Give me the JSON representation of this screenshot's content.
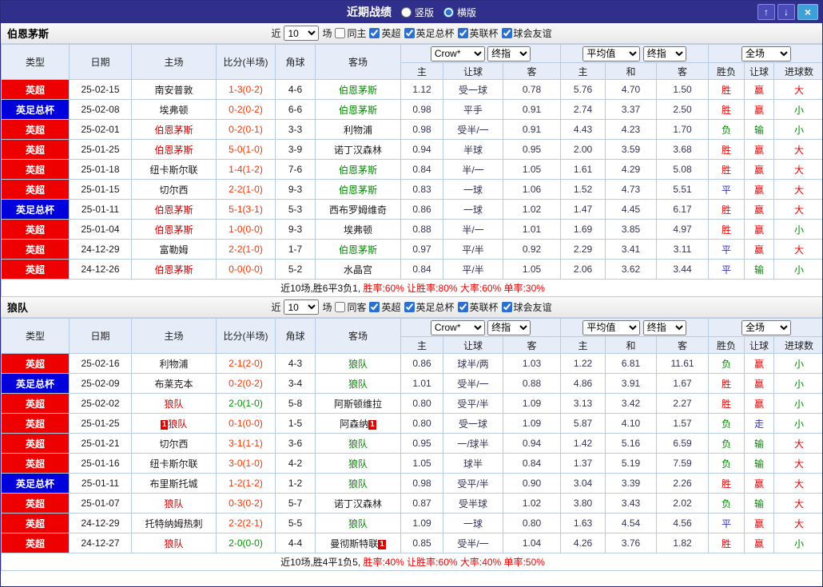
{
  "header": {
    "title": "近期战绩",
    "layout_options": [
      {
        "label": "竖版",
        "checked": false
      },
      {
        "label": "横版",
        "checked": true
      }
    ],
    "up_icon": "↑",
    "down_icon": "↓",
    "close_icon": "×"
  },
  "sections": [
    {
      "team": "伯恩茅斯",
      "filters": {
        "near": "近",
        "count": "10",
        "games": "场",
        "same": {
          "label": "同主",
          "checked": false
        },
        "leagues": [
          {
            "label": "英超",
            "checked": true
          },
          {
            "label": "英足总杯",
            "checked": true
          },
          {
            "label": "英联杯",
            "checked": true
          },
          {
            "label": "球会友谊",
            "checked": true
          }
        ]
      },
      "headers": {
        "type": "类型",
        "date": "日期",
        "home": "主场",
        "score": "比分(半场)",
        "corners": "角球",
        "away": "客场",
        "book_select": "Crow*",
        "stage_select1": "终指",
        "avg_select": "平均值",
        "stage_select2": "终指",
        "scope_select": "全场",
        "sub": [
          "主",
          "让球",
          "客",
          "主",
          "和",
          "客",
          "胜负",
          "让球",
          "进球数"
        ]
      },
      "rows": [
        {
          "league": "英超",
          "league_bg": "#ee0000",
          "date": "25-02-15",
          "home": "南安普敦",
          "home_color": "#1a1a1a",
          "home_badge": "",
          "score": "1-3(0-2)",
          "score_color": "#ff3300",
          "corners": "4-6",
          "away": "伯恩茅斯",
          "away_color": "#008800",
          "away_badge": "",
          "ah_home": "1.12",
          "handicap": "受一球",
          "ah_away": "0.78",
          "eu_home": "5.76",
          "eu_draw": "4.70",
          "eu_away": "1.50",
          "result": "胜",
          "result_color": "#ee0000",
          "cover": "赢",
          "cover_color": "#ee0000",
          "goals": "大",
          "goals_color": "#ee0000"
        },
        {
          "league": "英足总杯",
          "league_bg": "#0000dd",
          "date": "25-02-08",
          "home": "埃弗顿",
          "home_color": "#1a1a1a",
          "home_badge": "",
          "score": "0-2(0-2)",
          "score_color": "#ff3300",
          "corners": "6-6",
          "away": "伯恩茅斯",
          "away_color": "#008800",
          "away_badge": "",
          "ah_home": "0.98",
          "handicap": "平手",
          "ah_away": "0.91",
          "eu_home": "2.74",
          "eu_draw": "3.37",
          "eu_away": "2.50",
          "result": "胜",
          "result_color": "#ee0000",
          "cover": "赢",
          "cover_color": "#ee0000",
          "goals": "小",
          "goals_color": "#008800"
        },
        {
          "league": "英超",
          "league_bg": "#ee0000",
          "date": "25-02-01",
          "home": "伯恩茅斯",
          "home_color": "#cc0000",
          "home_badge": "",
          "score": "0-2(0-1)",
          "score_color": "#ff3300",
          "corners": "3-3",
          "away": "利物浦",
          "away_color": "#1a1a1a",
          "away_badge": "",
          "ah_home": "0.98",
          "handicap": "受半/一",
          "ah_away": "0.91",
          "eu_home": "4.43",
          "eu_draw": "4.23",
          "eu_away": "1.70",
          "result": "负",
          "result_color": "#008800",
          "cover": "输",
          "cover_color": "#008800",
          "goals": "小",
          "goals_color": "#008800"
        },
        {
          "league": "英超",
          "league_bg": "#ee0000",
          "date": "25-01-25",
          "home": "伯恩茅斯",
          "home_color": "#cc0000",
          "home_badge": "",
          "score": "5-0(1-0)",
          "score_color": "#ff3300",
          "corners": "3-9",
          "away": "诺丁汉森林",
          "away_color": "#1a1a1a",
          "away_badge": "",
          "ah_home": "0.94",
          "handicap": "半球",
          "ah_away": "0.95",
          "eu_home": "2.00",
          "eu_draw": "3.59",
          "eu_away": "3.68",
          "result": "胜",
          "result_color": "#ee0000",
          "cover": "赢",
          "cover_color": "#ee0000",
          "goals": "大",
          "goals_color": "#ee0000"
        },
        {
          "league": "英超",
          "league_bg": "#ee0000",
          "date": "25-01-18",
          "home": "纽卡斯尔联",
          "home_color": "#1a1a1a",
          "home_badge": "",
          "score": "1-4(1-2)",
          "score_color": "#ff3300",
          "corners": "7-6",
          "away": "伯恩茅斯",
          "away_color": "#008800",
          "away_badge": "",
          "ah_home": "0.84",
          "handicap": "半/一",
          "ah_away": "1.05",
          "eu_home": "1.61",
          "eu_draw": "4.29",
          "eu_away": "5.08",
          "result": "胜",
          "result_color": "#ee0000",
          "cover": "赢",
          "cover_color": "#ee0000",
          "goals": "大",
          "goals_color": "#ee0000"
        },
        {
          "league": "英超",
          "league_bg": "#ee0000",
          "date": "25-01-15",
          "home": "切尔西",
          "home_color": "#1a1a1a",
          "home_badge": "",
          "score": "2-2(1-0)",
          "score_color": "#ff3300",
          "corners": "9-3",
          "away": "伯恩茅斯",
          "away_color": "#008800",
          "away_badge": "",
          "ah_home": "0.83",
          "handicap": "一球",
          "ah_away": "1.06",
          "eu_home": "1.52",
          "eu_draw": "4.73",
          "eu_away": "5.51",
          "result": "平",
          "result_color": "#3030c0",
          "cover": "赢",
          "cover_color": "#ee0000",
          "goals": "大",
          "goals_color": "#ee0000"
        },
        {
          "league": "英足总杯",
          "league_bg": "#0000dd",
          "date": "25-01-11",
          "home": "伯恩茅斯",
          "home_color": "#cc0000",
          "home_badge": "",
          "score": "5-1(3-1)",
          "score_color": "#ff3300",
          "corners": "5-3",
          "away": "西布罗姆维奇",
          "away_color": "#1a1a1a",
          "away_badge": "",
          "ah_home": "0.86",
          "handicap": "一球",
          "ah_away": "1.02",
          "eu_home": "1.47",
          "eu_draw": "4.45",
          "eu_away": "6.17",
          "result": "胜",
          "result_color": "#ee0000",
          "cover": "赢",
          "cover_color": "#ee0000",
          "goals": "大",
          "goals_color": "#ee0000"
        },
        {
          "league": "英超",
          "league_bg": "#ee0000",
          "date": "25-01-04",
          "home": "伯恩茅斯",
          "home_color": "#cc0000",
          "home_badge": "",
          "score": "1-0(0-0)",
          "score_color": "#ff3300",
          "corners": "9-3",
          "away": "埃弗顿",
          "away_color": "#1a1a1a",
          "away_badge": "",
          "ah_home": "0.88",
          "handicap": "半/一",
          "ah_away": "1.01",
          "eu_home": "1.69",
          "eu_draw": "3.85",
          "eu_away": "4.97",
          "result": "胜",
          "result_color": "#ee0000",
          "cover": "赢",
          "cover_color": "#ee0000",
          "goals": "小",
          "goals_color": "#008800"
        },
        {
          "league": "英超",
          "league_bg": "#ee0000",
          "date": "24-12-29",
          "home": "富勒姆",
          "home_color": "#1a1a1a",
          "home_badge": "",
          "score": "2-2(1-0)",
          "score_color": "#ff3300",
          "corners": "1-7",
          "away": "伯恩茅斯",
          "away_color": "#008800",
          "away_badge": "",
          "ah_home": "0.97",
          "handicap": "平/半",
          "ah_away": "0.92",
          "eu_home": "2.29",
          "eu_draw": "3.41",
          "eu_away": "3.11",
          "result": "平",
          "result_color": "#3030c0",
          "cover": "赢",
          "cover_color": "#ee0000",
          "goals": "大",
          "goals_color": "#ee0000"
        },
        {
          "league": "英超",
          "league_bg": "#ee0000",
          "date": "24-12-26",
          "home": "伯恩茅斯",
          "home_color": "#cc0000",
          "home_badge": "",
          "score": "0-0(0-0)",
          "score_color": "#ff3300",
          "corners": "5-2",
          "away": "水晶宫",
          "away_color": "#1a1a1a",
          "away_badge": "",
          "ah_home": "0.84",
          "handicap": "平/半",
          "ah_away": "1.05",
          "eu_home": "2.06",
          "eu_draw": "3.62",
          "eu_away": "3.44",
          "result": "平",
          "result_color": "#3030c0",
          "cover": "输",
          "cover_color": "#008800",
          "goals": "小",
          "goals_color": "#008800"
        }
      ],
      "summary": {
        "prefix": "近10场,胜6平3负1, ",
        "rates": "胜率:60% 让胜率:80% 大率:60% 单率:30%"
      }
    },
    {
      "team": "狼队",
      "filters": {
        "near": "近",
        "count": "10",
        "games": "场",
        "same": {
          "label": "同客",
          "checked": false
        },
        "leagues": [
          {
            "label": "英超",
            "checked": true
          },
          {
            "label": "英足总杯",
            "checked": true
          },
          {
            "label": "英联杯",
            "checked": true
          },
          {
            "label": "球会友谊",
            "checked": true
          }
        ]
      },
      "headers": {
        "type": "类型",
        "date": "日期",
        "home": "主场",
        "score": "比分(半场)",
        "corners": "角球",
        "away": "客场",
        "book_select": "Crow*",
        "stage_select1": "终指",
        "avg_select": "平均值",
        "stage_select2": "终指",
        "scope_select": "全场",
        "sub": [
          "主",
          "让球",
          "客",
          "主",
          "和",
          "客",
          "胜负",
          "让球",
          "进球数"
        ]
      },
      "rows": [
        {
          "league": "英超",
          "league_bg": "#ee0000",
          "date": "25-02-16",
          "home": "利物浦",
          "home_color": "#1a1a1a",
          "home_badge": "",
          "score": "2-1(2-0)",
          "score_color": "#ff3300",
          "corners": "4-3",
          "away": "狼队",
          "away_color": "#008800",
          "away_badge": "",
          "ah_home": "0.86",
          "handicap": "球半/两",
          "ah_away": "1.03",
          "eu_home": "1.22",
          "eu_draw": "6.81",
          "eu_away": "11.61",
          "result": "负",
          "result_color": "#008800",
          "cover": "赢",
          "cover_color": "#ee0000",
          "goals": "小",
          "goals_color": "#008800"
        },
        {
          "league": "英足总杯",
          "league_bg": "#0000dd",
          "date": "25-02-09",
          "home": "布莱克本",
          "home_color": "#1a1a1a",
          "home_badge": "",
          "score": "0-2(0-2)",
          "score_color": "#ff3300",
          "corners": "3-4",
          "away": "狼队",
          "away_color": "#008800",
          "away_badge": "",
          "ah_home": "1.01",
          "handicap": "受半/一",
          "ah_away": "0.88",
          "eu_home": "4.86",
          "eu_draw": "3.91",
          "eu_away": "1.67",
          "result": "胜",
          "result_color": "#ee0000",
          "cover": "赢",
          "cover_color": "#ee0000",
          "goals": "小",
          "goals_color": "#008800"
        },
        {
          "league": "英超",
          "league_bg": "#ee0000",
          "date": "25-02-02",
          "home": "狼队",
          "home_color": "#cc0000",
          "home_badge": "",
          "score": "2-0(1-0)",
          "score_color": "#009900",
          "corners": "5-8",
          "away": "阿斯顿维拉",
          "away_color": "#1a1a1a",
          "away_badge": "",
          "ah_home": "0.80",
          "handicap": "受平/半",
          "ah_away": "1.09",
          "eu_home": "3.13",
          "eu_draw": "3.42",
          "eu_away": "2.27",
          "result": "胜",
          "result_color": "#ee0000",
          "cover": "赢",
          "cover_color": "#ee0000",
          "goals": "小",
          "goals_color": "#008800"
        },
        {
          "league": "英超",
          "league_bg": "#ee0000",
          "date": "25-01-25",
          "home": "狼队",
          "home_color": "#cc0000",
          "home_badge": "1",
          "score": "0-1(0-0)",
          "score_color": "#ff3300",
          "corners": "1-5",
          "away": "阿森纳",
          "away_color": "#1a1a1a",
          "away_badge": "1",
          "ah_home": "0.80",
          "handicap": "受一球",
          "ah_away": "1.09",
          "eu_home": "5.87",
          "eu_draw": "4.10",
          "eu_away": "1.57",
          "result": "负",
          "result_color": "#008800",
          "cover": "走",
          "cover_color": "#3030c0",
          "goals": "小",
          "goals_color": "#008800"
        },
        {
          "league": "英超",
          "league_bg": "#ee0000",
          "date": "25-01-21",
          "home": "切尔西",
          "home_color": "#1a1a1a",
          "home_badge": "",
          "score": "3-1(1-1)",
          "score_color": "#ff3300",
          "corners": "3-6",
          "away": "狼队",
          "away_color": "#008800",
          "away_badge": "",
          "ah_home": "0.95",
          "handicap": "一/球半",
          "ah_away": "0.94",
          "eu_home": "1.42",
          "eu_draw": "5.16",
          "eu_away": "6.59",
          "result": "负",
          "result_color": "#008800",
          "cover": "输",
          "cover_color": "#008800",
          "goals": "大",
          "goals_color": "#ee0000"
        },
        {
          "league": "英超",
          "league_bg": "#ee0000",
          "date": "25-01-16",
          "home": "纽卡斯尔联",
          "home_color": "#1a1a1a",
          "home_badge": "",
          "score": "3-0(1-0)",
          "score_color": "#ff3300",
          "corners": "4-2",
          "away": "狼队",
          "away_color": "#008800",
          "away_badge": "",
          "ah_home": "1.05",
          "handicap": "球半",
          "ah_away": "0.84",
          "eu_home": "1.37",
          "eu_draw": "5.19",
          "eu_away": "7.59",
          "result": "负",
          "result_color": "#008800",
          "cover": "输",
          "cover_color": "#008800",
          "goals": "大",
          "goals_color": "#ee0000"
        },
        {
          "league": "英足总杯",
          "league_bg": "#0000dd",
          "date": "25-01-11",
          "home": "布里斯托城",
          "home_color": "#1a1a1a",
          "home_badge": "",
          "score": "1-2(1-2)",
          "score_color": "#ff3300",
          "corners": "1-2",
          "away": "狼队",
          "away_color": "#008800",
          "away_badge": "",
          "ah_home": "0.98",
          "handicap": "受平/半",
          "ah_away": "0.90",
          "eu_home": "3.04",
          "eu_draw": "3.39",
          "eu_away": "2.26",
          "result": "胜",
          "result_color": "#ee0000",
          "cover": "赢",
          "cover_color": "#ee0000",
          "goals": "大",
          "goals_color": "#ee0000"
        },
        {
          "league": "英超",
          "league_bg": "#ee0000",
          "date": "25-01-07",
          "home": "狼队",
          "home_color": "#cc0000",
          "home_badge": "",
          "score": "0-3(0-2)",
          "score_color": "#ff3300",
          "corners": "5-7",
          "away": "诺丁汉森林",
          "away_color": "#1a1a1a",
          "away_badge": "",
          "ah_home": "0.87",
          "handicap": "受半球",
          "ah_away": "1.02",
          "eu_home": "3.80",
          "eu_draw": "3.43",
          "eu_away": "2.02",
          "result": "负",
          "result_color": "#008800",
          "cover": "输",
          "cover_color": "#008800",
          "goals": "大",
          "goals_color": "#ee0000"
        },
        {
          "league": "英超",
          "league_bg": "#ee0000",
          "date": "24-12-29",
          "home": "托特纳姆热刺",
          "home_color": "#1a1a1a",
          "home_badge": "",
          "score": "2-2(2-1)",
          "score_color": "#ff3300",
          "corners": "5-5",
          "away": "狼队",
          "away_color": "#008800",
          "away_badge": "",
          "ah_home": "1.09",
          "handicap": "一球",
          "ah_away": "0.80",
          "eu_home": "1.63",
          "eu_draw": "4.54",
          "eu_away": "4.56",
          "result": "平",
          "result_color": "#3030c0",
          "cover": "赢",
          "cover_color": "#ee0000",
          "goals": "大",
          "goals_color": "#ee0000"
        },
        {
          "league": "英超",
          "league_bg": "#ee0000",
          "date": "24-12-27",
          "home": "狼队",
          "home_color": "#cc0000",
          "home_badge": "",
          "score": "2-0(0-0)",
          "score_color": "#009900",
          "corners": "4-4",
          "away": "曼彻斯特联",
          "away_color": "#1a1a1a",
          "away_badge": "1",
          "ah_home": "0.85",
          "handicap": "受半/一",
          "ah_away": "1.04",
          "eu_home": "4.26",
          "eu_draw": "3.76",
          "eu_away": "1.82",
          "result": "胜",
          "result_color": "#ee0000",
          "cover": "赢",
          "cover_color": "#ee0000",
          "goals": "小",
          "goals_color": "#008800"
        }
      ],
      "summary": {
        "prefix": "近10场,胜4平1负5, ",
        "rates": "胜率:40% 让胜率:60% 大率:40% 单率:50%"
      }
    }
  ]
}
